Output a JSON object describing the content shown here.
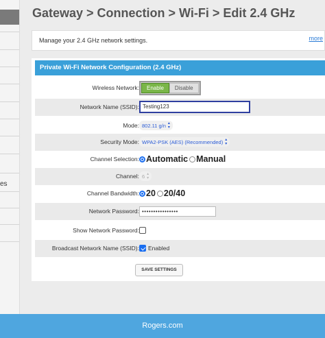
{
  "sidebar": {
    "partial_label": "es"
  },
  "breadcrumb": "Gateway > Connection > Wi-Fi > Edit 2.4 GHz",
  "info": {
    "description": "Manage your 2.4 GHz network settings.",
    "more_link": "more"
  },
  "panel": {
    "title": "Private Wi-Fi Network Configuration (2.4 GHz)",
    "wireless_network": {
      "label": "Wireless Network:",
      "enable": "Enable",
      "disable": "Disable",
      "state": "enabled"
    },
    "ssid": {
      "label": "Network Name (SSID):",
      "value": "Testing123"
    },
    "mode": {
      "label": "Mode:",
      "value": "802.11 g/n"
    },
    "security": {
      "label": "Security Mode:",
      "value": "WPA2-PSK (AES) (Recommended)"
    },
    "channel_selection": {
      "label": "Channel Selection:",
      "options": [
        "Automatic",
        "Manual"
      ],
      "selected": "Automatic"
    },
    "channel": {
      "label": "Channel:",
      "value": "6"
    },
    "bandwidth": {
      "label": "Channel Bandwidth:",
      "options": [
        "20",
        "20/40"
      ],
      "selected": "20"
    },
    "password": {
      "label": "Network Password:",
      "value": "••••••••••••••••"
    },
    "show_password": {
      "label": "Show Network Password:",
      "checked": false
    },
    "broadcast": {
      "label": "Broadcast Network Name (SSID):",
      "checkbox_label": "Enabled",
      "checked": true
    },
    "save_label": "SAVE SETTINGS"
  },
  "footer": {
    "text": "Rogers.com"
  },
  "colors": {
    "accent": "#3aa0d9",
    "footer": "#4fa6df",
    "enable_green": "#7ab648",
    "radio_blue": "#1a6ef0"
  },
  "icons": {
    "select_arrows": "updown-chevron-icon"
  }
}
